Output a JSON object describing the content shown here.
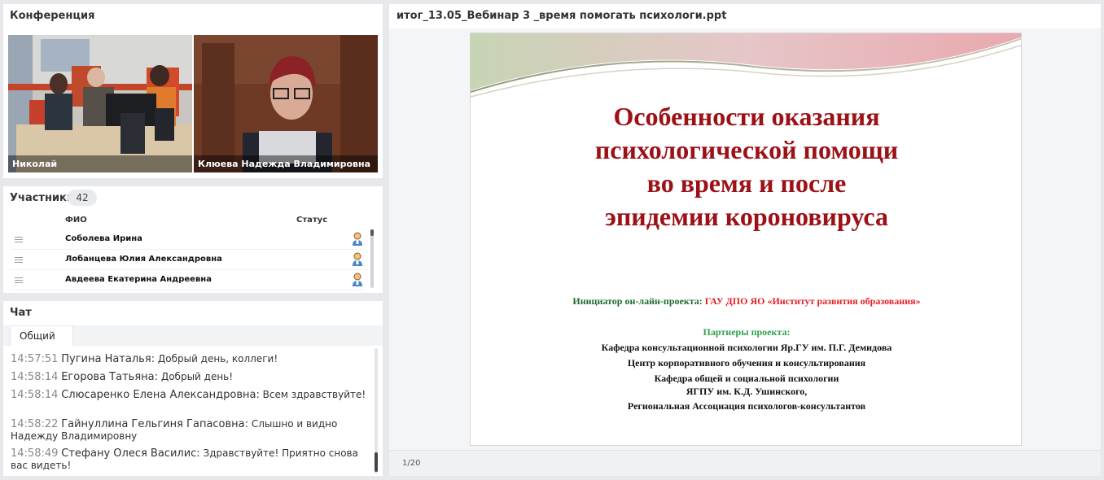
{
  "conference": {
    "title": "Конференция",
    "videos": [
      {
        "name": "Николай"
      },
      {
        "name": "Клюева Надежда  Владимировна"
      }
    ]
  },
  "participants": {
    "title": "Участники",
    "count": "42",
    "columns": {
      "name": "ФИО",
      "status": "Статус"
    },
    "rows": [
      {
        "name": "Соболева Ирина",
        "status_icon": "user-icon"
      },
      {
        "name": "Лобанцева  Юлия  Александровна",
        "status_icon": "user-icon"
      },
      {
        "name": "Авдеева Екатерина  Андреевна",
        "status_icon": "user-icon"
      }
    ]
  },
  "chat": {
    "title": "Чат",
    "tab": "Общий",
    "messages": [
      {
        "time": "14:57:51",
        "author": "Пугина Наталья:",
        "text": "Добрый день, коллеги!"
      },
      {
        "time": "14:58:14",
        "author": "Егорова Татьяна:",
        "text": "Добрый день!"
      },
      {
        "time": "14:58:14",
        "author": "Слюсаренко Елена  Александровна:",
        "text": "Всем здравствуйте!"
      },
      {
        "time": "14:58:22",
        "author": "Гайнуллина Гельгиня  Гапасовна:",
        "text": "Слышно  и видно Надежду Владимировну"
      },
      {
        "time": "14:58:49",
        "author": "Стефану Олеся  Василис:",
        "text": "Здравствуйте! Приятно снова вас видеть!"
      }
    ]
  },
  "presentation": {
    "file_name": "итог_13.05_Вебинар 3 _время помогать психологи.ppt",
    "page_indicator": "1/20",
    "slide": {
      "title_lines": [
        "Особенности оказания",
        "психологической помощи",
        "во время и после",
        "эпидемии короновируса"
      ],
      "initiator_label": "Инициатор  он-лайн-проекта:",
      "initiator_value": "ГАУ ДПО ЯО «Институт развития образования»",
      "partners_title": "Партнеры  проекта:",
      "partners": [
        "Кафедра консультационной психологии Яр.ГУ им. П.Г. Демидова",
        "Центр корпоративного обучения и консультирования",
        "Кафедра общей и социальной психологии",
        "ЯГПУ им. К.Д. Ушинского,",
        "Региональная  Ассоциация психологов-консультантов"
      ],
      "colors": {
        "title": "#9c1016",
        "initiator_label": "#1d6b2f",
        "initiator_value": "#e31e24",
        "partners_title": "#2fa24a"
      }
    }
  }
}
